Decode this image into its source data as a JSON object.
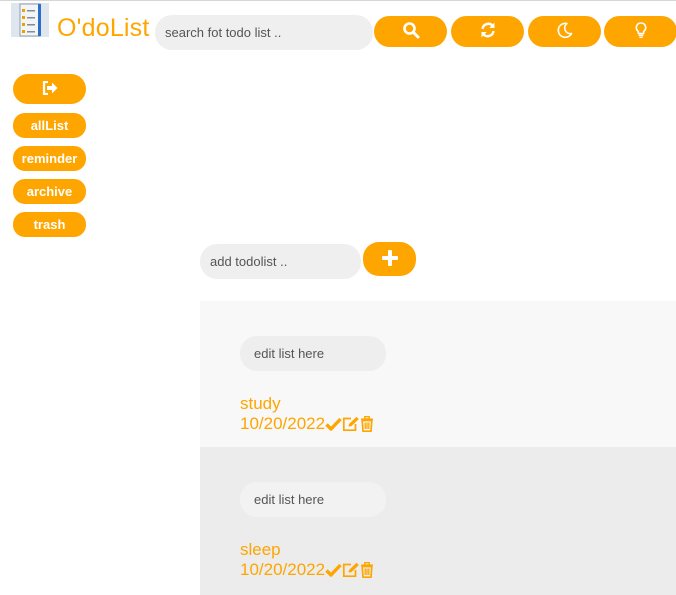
{
  "app": {
    "name": "O'doList"
  },
  "search": {
    "placeholder": "search fot todo list .."
  },
  "toolbar": {
    "icons": [
      "search-icon",
      "refresh-icon",
      "moon-icon",
      "lightbulb-icon"
    ]
  },
  "sidebar": {
    "logout_icon": "sign-out-icon",
    "items": [
      {
        "label": "allList"
      },
      {
        "label": "reminder"
      },
      {
        "label": "archive"
      },
      {
        "label": "trash"
      }
    ]
  },
  "add_todo": {
    "placeholder": "add todolist ..",
    "button_icon": "plus-icon"
  },
  "todos": [
    {
      "edit_placeholder": "edit list here",
      "title": "study",
      "date": "10/20/2022"
    },
    {
      "edit_placeholder": "edit list here",
      "title": "sleep",
      "date": "10/20/2022"
    }
  ],
  "colors": {
    "accent": "#ffa500",
    "input_bg": "#efefef",
    "card1_bg": "#f8f8f8",
    "card2_bg": "#ececec"
  }
}
